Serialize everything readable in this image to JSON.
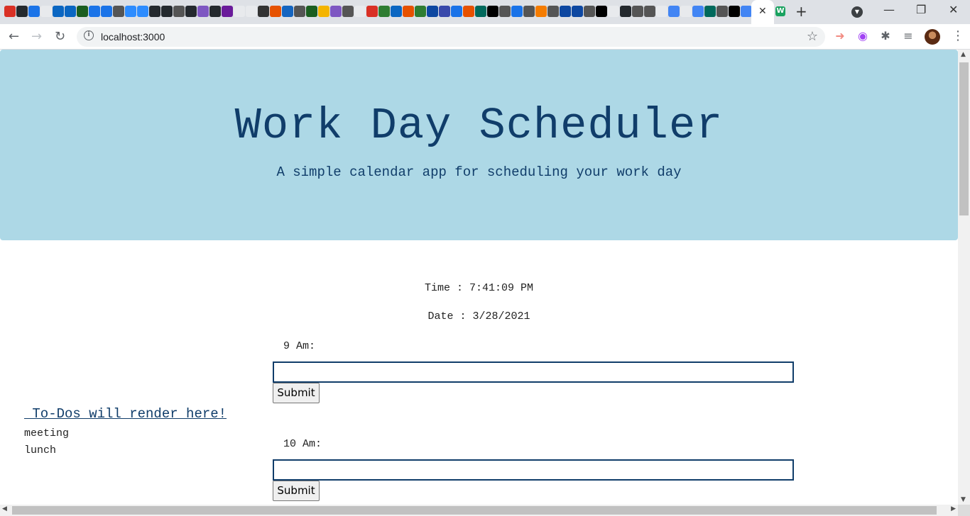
{
  "browser": {
    "url": "localhost:3000",
    "active_tab_close": "✕",
    "new_tab": "+",
    "favicon_colors": [
      "#d93025",
      "#24292e",
      "#1a73e8",
      "#e8eaed",
      "#0a66c2",
      "#0a66c2",
      "#1b5e20",
      "#1a73e8",
      "#1a73e8",
      "#555",
      "#2d8cff",
      "#2d8cff",
      "#24292e",
      "#24292e",
      "#555",
      "#24292e",
      "#7e57c2",
      "#24292e",
      "#6a1b9a",
      "#e8eaed",
      "#e8eaed",
      "#333",
      "#e65100",
      "#1565c0",
      "#555",
      "#1b5e20",
      "#f4b400",
      "#7e57c2",
      "#555",
      "#e8eaed",
      "#d93025",
      "#2e7d32",
      "#0a66c2",
      "#e65100",
      "#2e7d32",
      "#0d47a1",
      "#3949ab",
      "#1a73e8",
      "#e65100",
      "#00695c",
      "#000",
      "#555",
      "#1a73e8",
      "#555",
      "#f57c00",
      "#555",
      "#0d47a1",
      "#0d47a1",
      "#555",
      "#000",
      "#e8eaed",
      "#24292e",
      "#555",
      "#555",
      "#e8eaed",
      "#4285f4",
      "#e8eaed",
      "#4285f4",
      "#00695c",
      "#555",
      "#000",
      "#4285f4"
    ]
  },
  "header": {
    "title": "Work Day Scheduler",
    "subtitle": "A simple calendar app for scheduling your work day"
  },
  "clock": {
    "time": "Time : 7:41:09 PM",
    "date": "Date : 3/28/2021"
  },
  "todos": {
    "heading": " To-Dos will render here!",
    "items": [
      "meeting",
      "lunch"
    ]
  },
  "slots": [
    {
      "label": "9 Am:",
      "value": "",
      "button": "Submit"
    },
    {
      "label": "10 Am:",
      "value": "",
      "button": "Submit"
    }
  ]
}
